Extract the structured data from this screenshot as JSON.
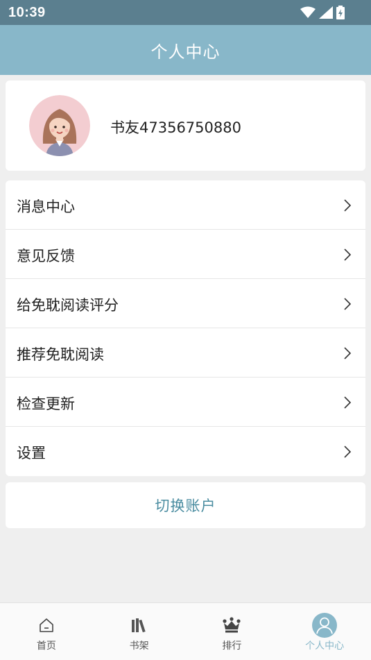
{
  "status_bar": {
    "time": "10:39"
  },
  "header": {
    "title": "个人中心"
  },
  "profile": {
    "username": "书友47356750880"
  },
  "menu": {
    "items": [
      {
        "label": "消息中心"
      },
      {
        "label": "意见反馈"
      },
      {
        "label": "给免耽阅读评分"
      },
      {
        "label": "推荐免耽阅读"
      },
      {
        "label": "检查更新"
      },
      {
        "label": "设置"
      }
    ]
  },
  "switch_account": {
    "label": "切换账户"
  },
  "tabs": [
    {
      "label": "首页",
      "icon": "home-icon"
    },
    {
      "label": "书架",
      "icon": "bookshelf-icon"
    },
    {
      "label": "排行",
      "icon": "crown-icon"
    },
    {
      "label": "个人中心",
      "icon": "user-icon",
      "active": true
    }
  ],
  "colors": {
    "header": "#88b7c9",
    "status_bar": "#5b7f8f",
    "accent": "#4a8ca0"
  }
}
